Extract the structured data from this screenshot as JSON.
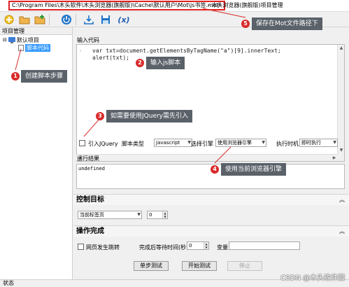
{
  "window": {
    "title_path": "C:\\Program Files\\木头软件\\木头浏览器(旗舰版)\\Cache\\默认用户\\Mot\\js书签.mot*",
    "title_suffix": "- 木头浏览器(旗舰版)项目管理"
  },
  "toolbar": {
    "icons": [
      "new-icon",
      "open-folder-icon",
      "add-folder-icon",
      "power-icon",
      "download-icon",
      "save-icon",
      "formula-icon"
    ],
    "formula_label": "(x)"
  },
  "left_panel": {
    "header": "项目管理",
    "tree": {
      "root_label": "默认项目",
      "child_label": "脚本代码"
    }
  },
  "right_panel": {
    "code_section_label": "输入代码",
    "code_lines": [
      "var txt=document.getElementsByTagName(\"a\")[9].innerText;",
      "alert(txt);"
    ],
    "fold_marker": "-",
    "options": {
      "jquery_label": "引入JQuery",
      "jquery_checked": false,
      "script_type_label": "脚本类型",
      "script_type_value": "Javascript",
      "engine_label": "选择引擎",
      "engine_value": "使用浏览器引擎",
      "exec_timing_label": "执行时机",
      "exec_timing_value": "即时执行"
    },
    "result_section_label": "运行结果",
    "result_text": "undefined",
    "control_target": {
      "title": "控制目标",
      "tab_value": "当前标签页",
      "index_value": "0"
    },
    "operation_complete": {
      "title": "操作完成",
      "page_jump_label": "网页发生跳转",
      "page_jump_checked": false,
      "wait_label": "完成后等待时间(秒)",
      "wait_value": "0",
      "variable_label": "变量",
      "variable_value": ""
    },
    "buttons": {
      "single_step": "单步测试",
      "start_test": "开始测试",
      "stop": "停止"
    }
  },
  "statusbar": {
    "text": "状态"
  },
  "watermark": "CSDN @木头软件园",
  "annotations": [
    {
      "number": "1",
      "text": "创建脚本步骤"
    },
    {
      "number": "2",
      "text": "输入js脚本"
    },
    {
      "number": "3",
      "text": "如需要使用JQuery需先引入"
    },
    {
      "number": "4",
      "text": "使用当前浏览器引擎"
    },
    {
      "number": "5",
      "text": "保存在Mot文件路径下"
    }
  ],
  "colors": {
    "annotation_red": "#d92a2a",
    "annotation_bg": "#5a6169",
    "selection_blue": "#3399ff"
  }
}
